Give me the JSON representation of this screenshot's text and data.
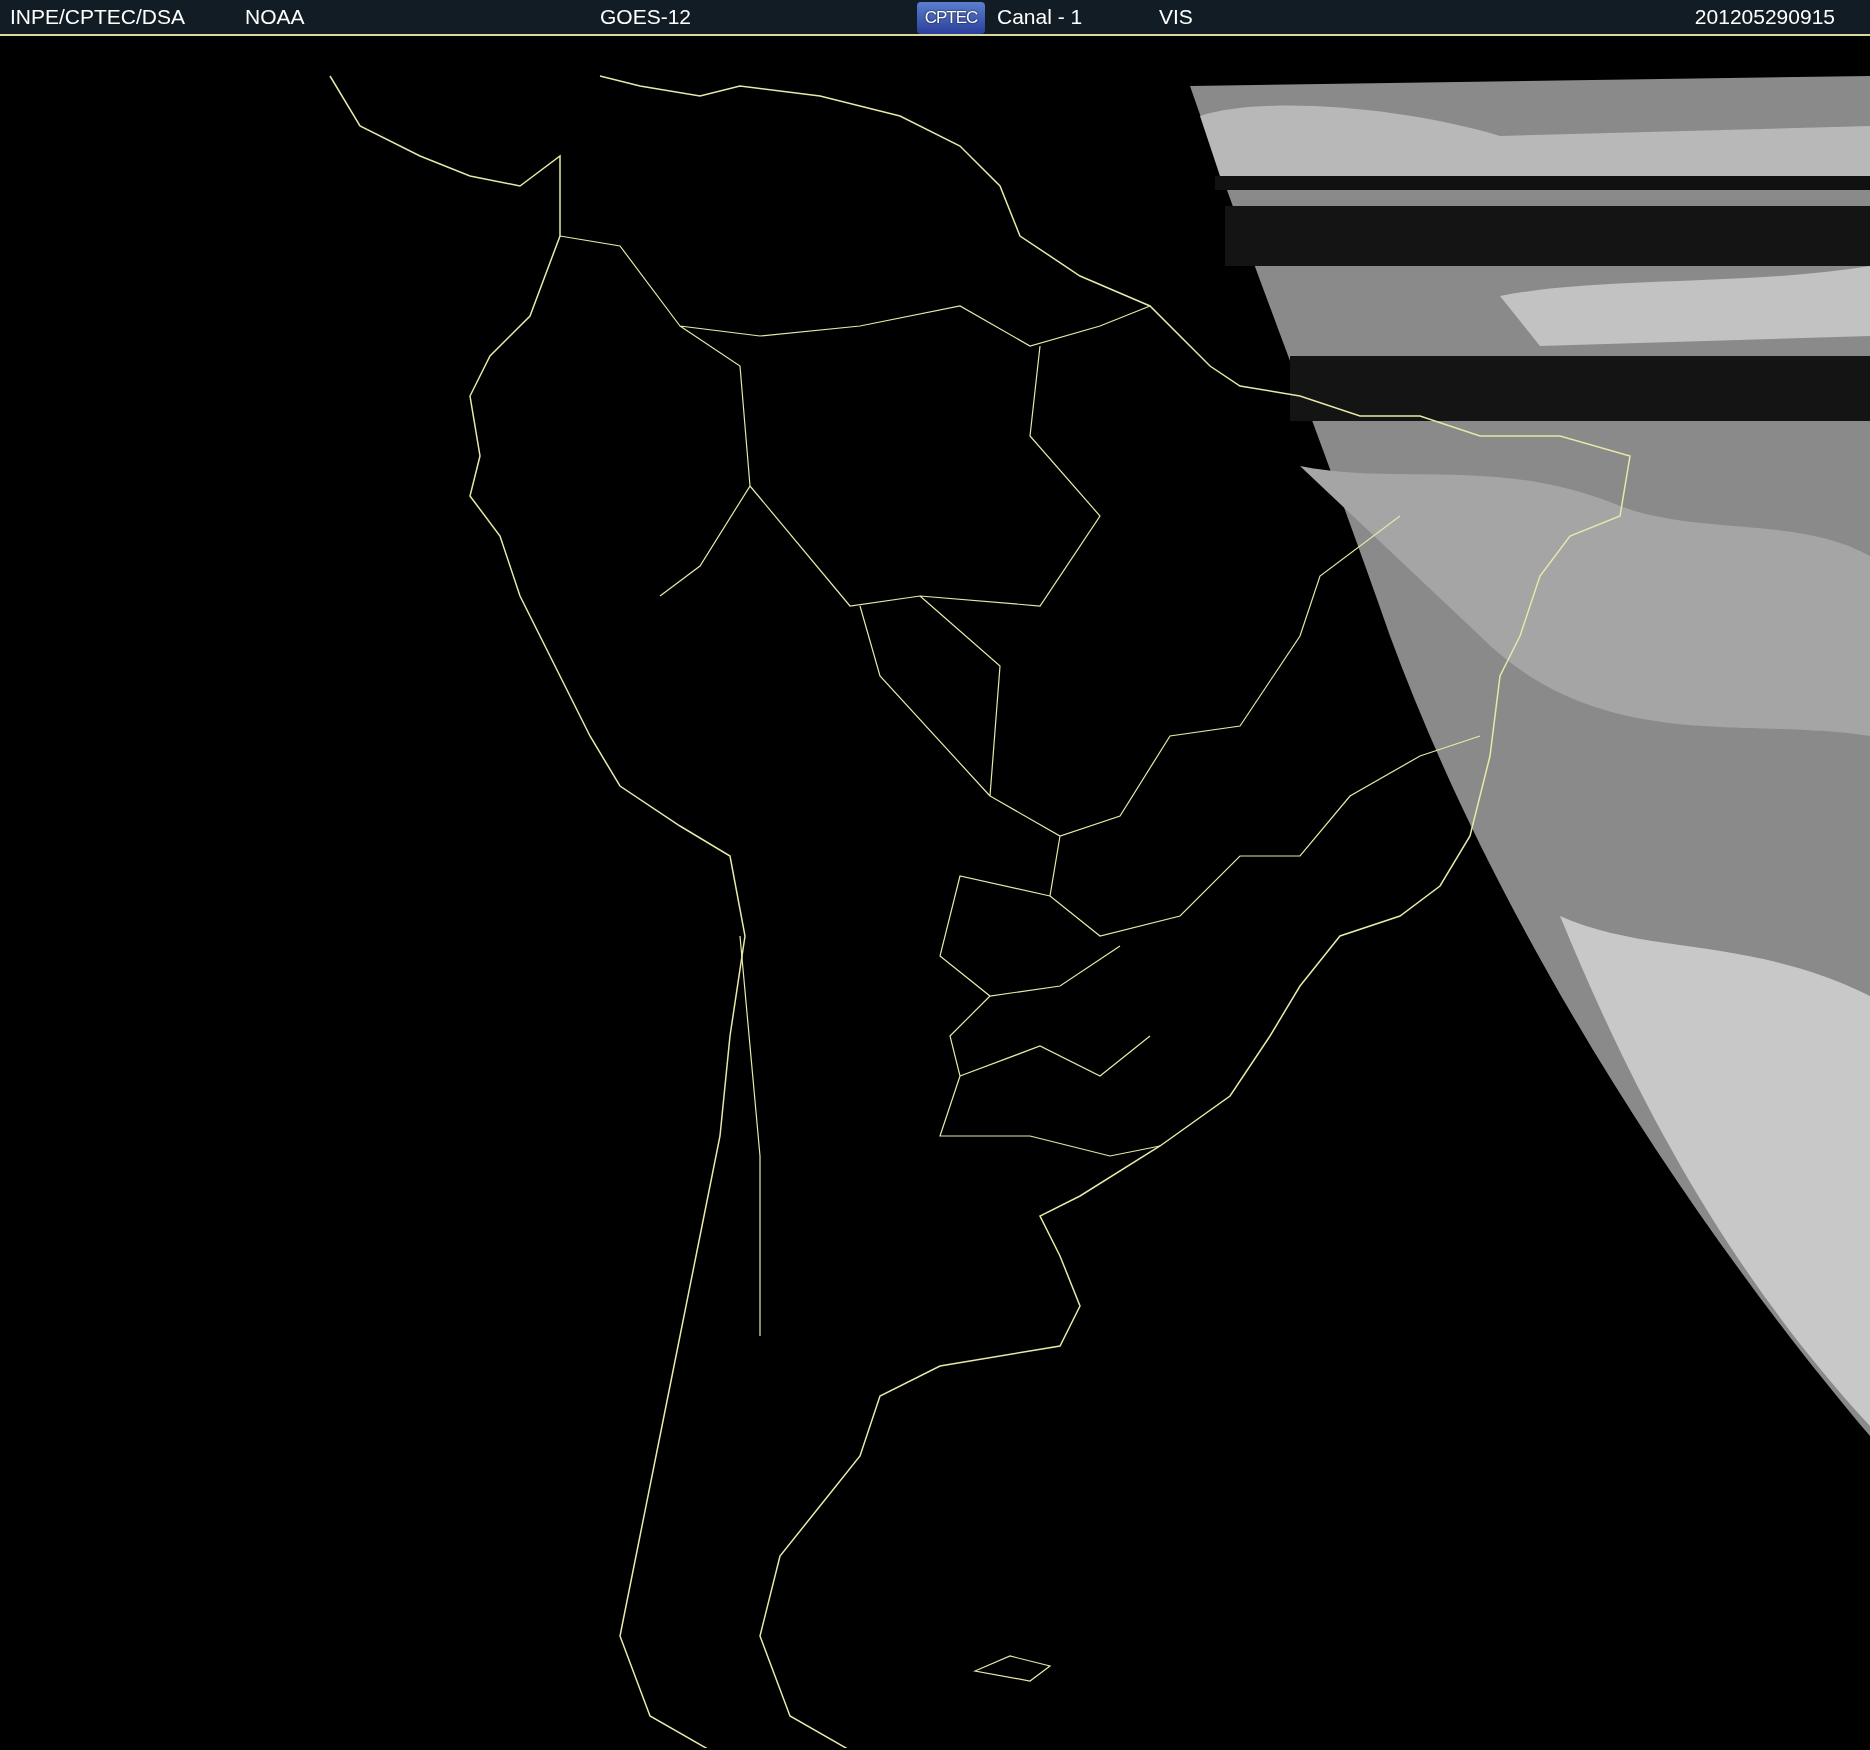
{
  "header": {
    "source": "INPE/CPTEC/DSA",
    "agency": "NOAA",
    "satellite": "GOES-12",
    "logo": "CPTEC",
    "channel": "Canal - 1",
    "band": "VIS",
    "timestamp": "201205290915"
  }
}
